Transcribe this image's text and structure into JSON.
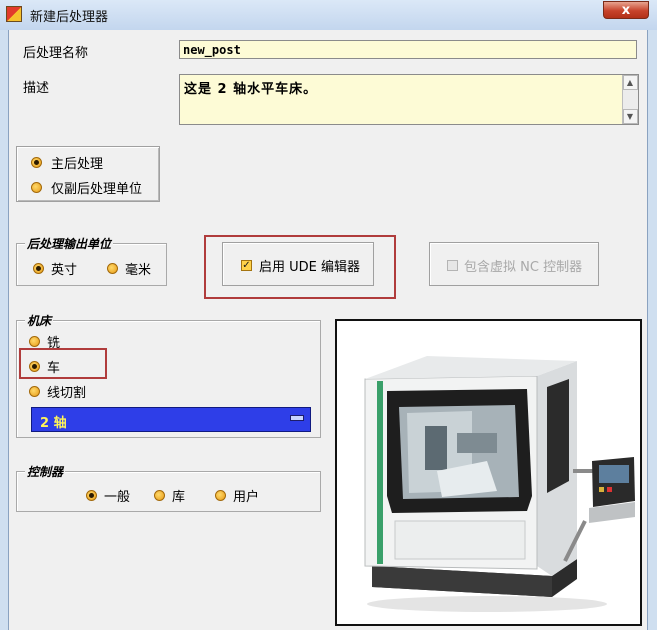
{
  "window": {
    "title": "新建后处理器",
    "close_glyph": "x"
  },
  "fields": {
    "name_label": "后处理名称",
    "name_value": "new_post",
    "description_label": "描述",
    "description_value": "这是 2 轴水平车床。"
  },
  "post_type": {
    "options": [
      {
        "label": "主后处理",
        "selected": true
      },
      {
        "label": "仅副后处理单位",
        "selected": false
      }
    ]
  },
  "output_units": {
    "legend": "后处理输出单位",
    "options": [
      {
        "label": "英寸",
        "selected": true
      },
      {
        "label": "毫米",
        "selected": false
      }
    ]
  },
  "ude": {
    "label": "启用 UDE 编辑器",
    "checked": true
  },
  "virtual_nc": {
    "label": "包含虚拟 NC 控制器",
    "checked": false,
    "enabled": false
  },
  "machine": {
    "legend": "机床",
    "options": [
      {
        "label": "铣",
        "selected": false
      },
      {
        "label": "车",
        "selected": true
      },
      {
        "label": "线切割",
        "selected": false
      }
    ],
    "axis_value": "2 轴"
  },
  "controller": {
    "legend": "控制器",
    "options": [
      {
        "label": "一般",
        "selected": true
      },
      {
        "label": "库",
        "selected": false
      },
      {
        "label": "用户",
        "selected": false
      }
    ]
  },
  "colors": {
    "highlight_frame": "#b03c3c",
    "dropdown_bg": "#2e3ee8",
    "dropdown_text": "#fff45a",
    "input_bg": "#fdfbd6"
  },
  "icons": {
    "app": "app-icon",
    "close": "close-icon",
    "scroll_up": "scroll-up-icon",
    "scroll_down": "scroll-down-icon",
    "dropdown": "dropdown-bar-icon",
    "machine_preview": "lathe-machine-image"
  }
}
